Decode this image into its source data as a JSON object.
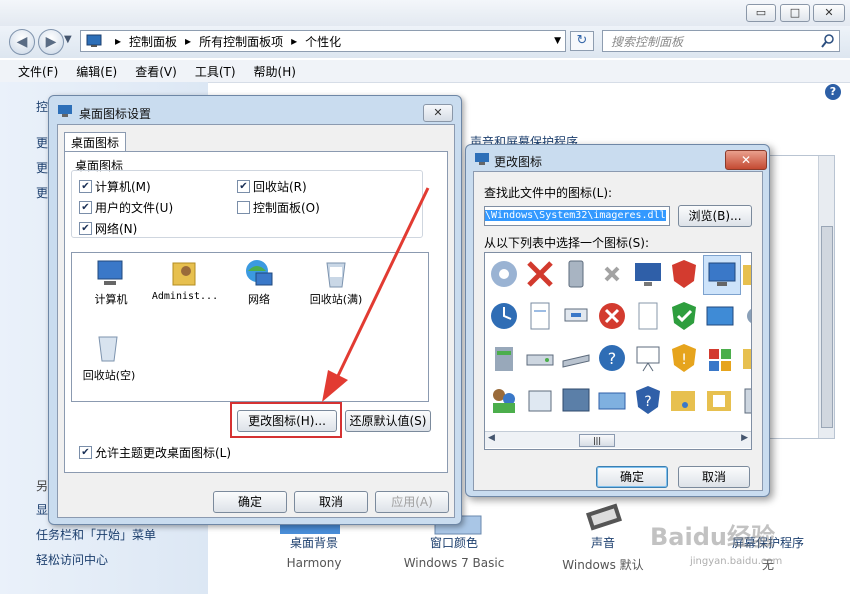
{
  "window": {
    "min_label": "▭",
    "max_label": "□",
    "close_label": "✕",
    "back_label": "◀",
    "forward_label": "▶",
    "refresh_label": "↻",
    "help_label": "?"
  },
  "address": {
    "crumbs": [
      "控制面板",
      "所有控制面板项",
      "个性化"
    ],
    "separator": "▸"
  },
  "search": {
    "placeholder": "搜索控制面板"
  },
  "menu": [
    "文件(F)",
    "编辑(E)",
    "查看(V)",
    "工具(T)",
    "帮助(H)"
  ],
  "left_pane": {
    "partial": [
      "控",
      "更",
      "更",
      "更",
      "另",
      "显"
    ],
    "links": [
      "任务栏和「开始」菜单",
      "轻松访问中心"
    ]
  },
  "background": {
    "section_heading": "声音和屏幕保护程序",
    "bottom_items": [
      {
        "label": "桌面背景",
        "sub": "Harmony"
      },
      {
        "label": "窗口颜色",
        "sub": "Windows 7 Basic"
      },
      {
        "label": "声音",
        "sub": "Windows 默认"
      },
      {
        "label": "屏幕保护程序",
        "sub": "无"
      }
    ]
  },
  "dialog1": {
    "title": "桌面图标设置",
    "tab": "桌面图标",
    "group_label": "桌面图标",
    "checkboxes": [
      {
        "label": "计算机(M)",
        "checked": true
      },
      {
        "label": "回收站(R)",
        "checked": true
      },
      {
        "label": "用户的文件(U)",
        "checked": true
      },
      {
        "label": "控制面板(O)",
        "checked": false
      },
      {
        "label": "网络(N)",
        "checked": true
      }
    ],
    "icons": [
      "计算机",
      "Administ...",
      "网络",
      "回收站(满)",
      "回收站(空)"
    ],
    "change_icon_button": "更改图标(H)...",
    "restore_default_button": "还原默认值(S)",
    "allow_theme": "允许主题更改桌面图标(L)",
    "ok": "确定",
    "cancel": "取消",
    "apply": "应用(A)"
  },
  "dialog2": {
    "title": "更改图标",
    "find_label": "查找此文件中的图标(L):",
    "file_path": "\\Windows\\System32\\imageres.dll",
    "browse": "浏览(B)...",
    "select_label": "从以下列表中选择一个图标(S):",
    "ok": "确定",
    "cancel": "取消",
    "scroll_thumb": "|||"
  },
  "watermark": {
    "text": "Baidu经验",
    "url_text": "jingyan.baidu.com"
  },
  "colors": {
    "accent": "#1c3f6e",
    "highlight": "#d53232",
    "arrow": "#e23b32"
  }
}
